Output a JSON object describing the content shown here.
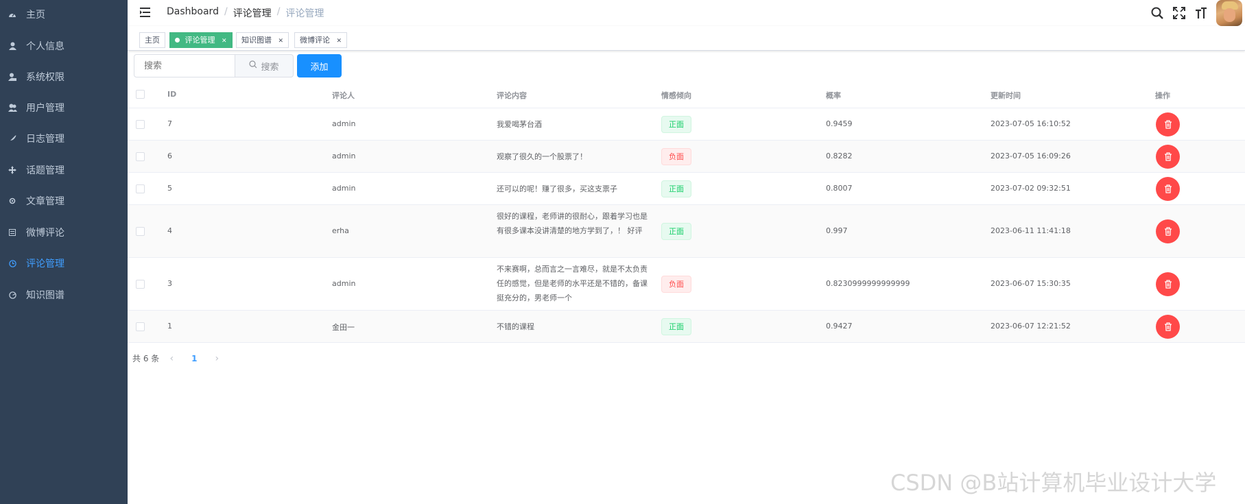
{
  "sidebar": {
    "items": [
      {
        "label": "主页",
        "icon": "dashboard-icon",
        "active": false
      },
      {
        "label": "个人信息",
        "icon": "user-icon",
        "active": false
      },
      {
        "label": "系统权限",
        "icon": "user-lock-icon",
        "active": false
      },
      {
        "label": "用户管理",
        "icon": "users-icon",
        "active": false
      },
      {
        "label": "日志管理",
        "icon": "feather-icon",
        "active": false
      },
      {
        "label": "话题管理",
        "icon": "move-icon",
        "active": false
      },
      {
        "label": "文章管理",
        "icon": "gear-icon",
        "active": false
      },
      {
        "label": "微博评论",
        "icon": "list-icon",
        "active": false
      },
      {
        "label": "评论管理",
        "icon": "clock-icon",
        "active": true
      },
      {
        "label": "知识图谱",
        "icon": "chart-icon",
        "active": false
      }
    ]
  },
  "navbar": {
    "breadcrumb": [
      "Dashboard",
      "评论管理",
      "评论管理"
    ]
  },
  "tags": [
    {
      "label": "主页",
      "active": false,
      "closable": false
    },
    {
      "label": "评论管理",
      "active": true,
      "closable": true
    },
    {
      "label": "知识图谱",
      "active": false,
      "closable": true
    },
    {
      "label": "微博评论",
      "active": false,
      "closable": true
    }
  ],
  "toolbar": {
    "search_placeholder": "搜索",
    "search_button": "搜索",
    "add_button": "添加"
  },
  "table": {
    "columns": [
      "ID",
      "评论人",
      "评论内容",
      "情感倾向",
      "概率",
      "更新时间",
      "操作"
    ],
    "rows": [
      {
        "id": "7",
        "user": "admin",
        "content": "我爱喝茅台酒",
        "sentiment": "正面",
        "positive": true,
        "prob": "0.9459",
        "time": "2023-07-05 16:10:52"
      },
      {
        "id": "6",
        "user": "admin",
        "content": "观察了很久的一个股票了！",
        "sentiment": "负面",
        "positive": false,
        "prob": "0.8282",
        "time": "2023-07-05 16:09:26"
      },
      {
        "id": "5",
        "user": "admin",
        "content": "还可以的呢！赚了很多，买这支票子",
        "sentiment": "正面",
        "positive": true,
        "prob": "0.8007",
        "time": "2023-07-02 09:32:51"
      },
      {
        "id": "4",
        "user": "erha",
        "content": "很好的课程，老师讲的很耐心，跟着学习也是有很多课本没讲清楚的地方学到了，！ 好评",
        "sentiment": "正面",
        "positive": true,
        "prob": "0.997",
        "time": "2023-06-11 11:41:18"
      },
      {
        "id": "3",
        "user": "admin",
        "content": "不来赛啊，总而言之一言难尽，就是不太负责任的感觉，但是老师的水平还是不错的，备课挺充分的，男老师一个",
        "sentiment": "负面",
        "positive": false,
        "prob": "0.8230999999999999",
        "time": "2023-06-07 15:30:35"
      },
      {
        "id": "1",
        "user": "金田一",
        "content": "不错的课程",
        "sentiment": "正面",
        "positive": true,
        "prob": "0.9427",
        "time": "2023-06-07 12:21:52"
      }
    ]
  },
  "pagination": {
    "total_text": "共 6 条",
    "current_page": "1"
  },
  "watermark": "CSDN @B站计算机毕业设计大学",
  "colors": {
    "sidebar_bg": "#304156",
    "active_menu": "#409eff",
    "active_tag": "#42b983",
    "primary": "#1890ff",
    "danger": "#ff4949"
  }
}
